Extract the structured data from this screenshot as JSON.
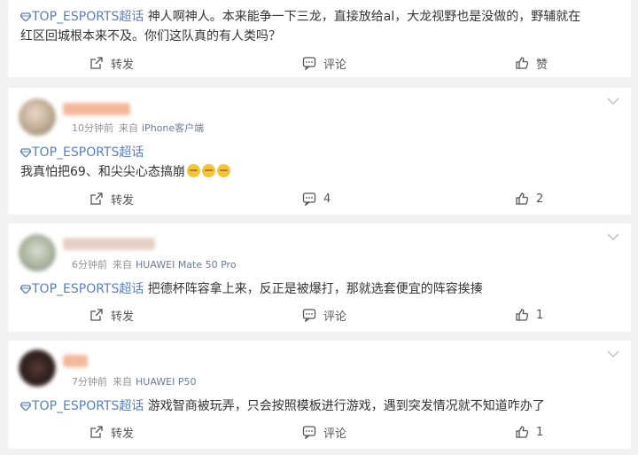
{
  "colors": {
    "tag": "#5b7fb8",
    "source": "#6b7a99",
    "meta": "#939393",
    "background": "#f2f2f2"
  },
  "actions_labels": {
    "share": "转发",
    "comment": "评论",
    "like": "赞"
  },
  "posts": [
    {
      "tag": "TOP_ESPORTS超话",
      "text_line1": " 神人啊神人。本来能争一下三龙，直接放给al，大龙视野也是没做的，野辅就在",
      "text_line2": "红区回城根本来不及。你们这队真的有人类吗？",
      "share": "转发",
      "comment": "评论",
      "like": "赞"
    },
    {
      "time": "10分钟前",
      "source_prefix": "来自",
      "source": "iPhone客户端",
      "tag": "TOP_ESPORTS超话",
      "text": "我真怕把69、和尖尖心态搞崩",
      "share": "转发",
      "comment": "4",
      "like": "2"
    },
    {
      "time": "6分钟前",
      "source_prefix": "来自",
      "source": "HUAWEI Mate 50 Pro",
      "tag": "TOP_ESPORTS超话",
      "text": " 把德杯阵容拿上来，反正是被爆打，那就选套便宜的阵容挨揍",
      "share": "转发",
      "comment": "评论",
      "like": "1"
    },
    {
      "time": "7分钟前",
      "source_prefix": "来自",
      "source": "HUAWEI P50",
      "tag": "TOP_ESPORTS超话",
      "text": " 游戏智商被玩弄，只会按照模板进行游戏，遇到突发情况就不知道咋办了",
      "share": "转发",
      "comment": "评论",
      "like": "1"
    }
  ]
}
